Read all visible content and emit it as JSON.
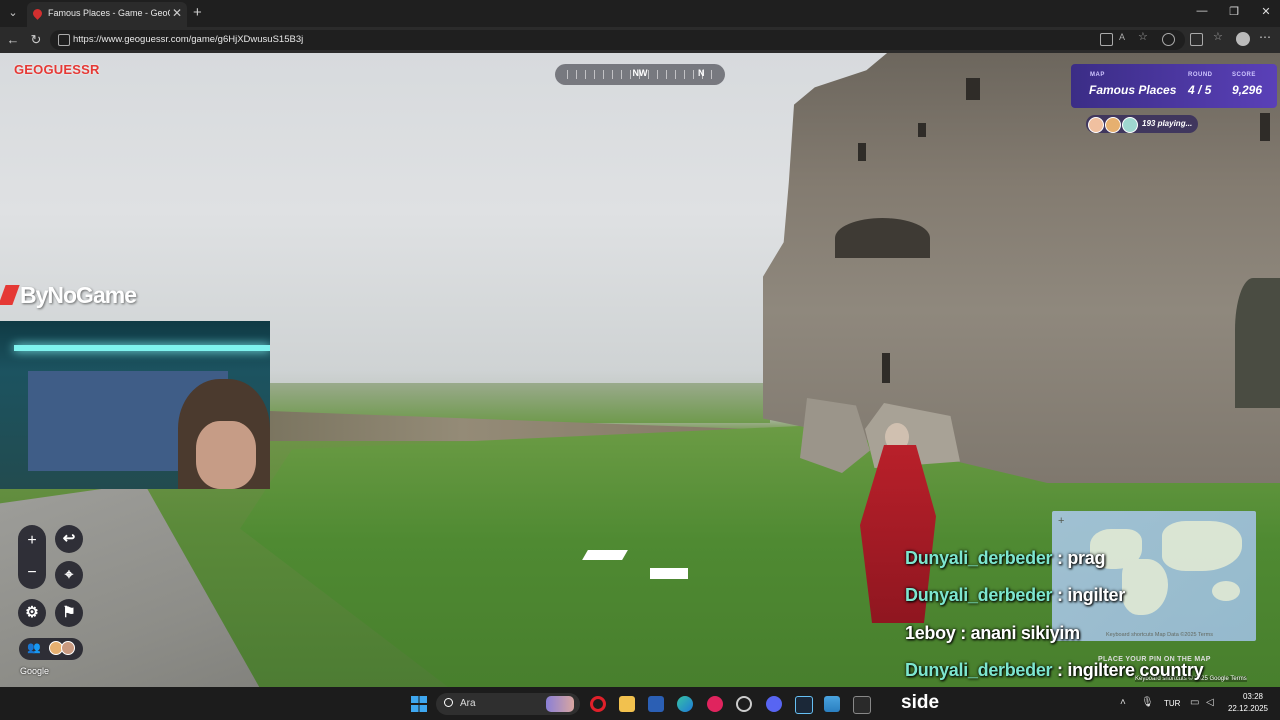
{
  "browser": {
    "tab_title": "Famous Places - Game - GeoGuessr",
    "url": "https://www.geoguessr.com/game/g6HjXDwusuS15B3j"
  },
  "game": {
    "logo": "GEOGUESSR",
    "compass_heading": "NW",
    "compass_next": "N",
    "map_label": "MAP",
    "map_name": "Famous Places",
    "round_label": "ROUND",
    "round_value": "4 / 5",
    "score_label": "SCORE",
    "score_value": "9,296",
    "players_text": "193 playing...",
    "google_mark": "Google",
    "minimap_footer": "Keyboard shortcuts    Map Data ©2025    Terms",
    "map_place_hint": "PLACE YOUR PIN ON THE MAP",
    "google_footer": "Keyboard shortcuts  © 2025 Google  Terms",
    "controls": {
      "zoom_in": "+",
      "zoom_out": "−",
      "undo": "↩",
      "pin": "⌖",
      "settings": "⚙",
      "flag": "⚑"
    }
  },
  "overlay": {
    "brand": "ByNoGame",
    "chat": [
      {
        "user": "Dunyali_derbeder",
        "message": ": prag"
      },
      {
        "user": "Dunyali_derbeder",
        "message": ": ingilter"
      },
      {
        "user": "1eboy",
        "message": ": anani sikiyim"
      },
      {
        "user": "Dunyali_derbeder",
        "message": ": ingiltere country"
      }
    ]
  },
  "taskbar": {
    "search_placeholder": "Ara",
    "side_text": "side",
    "language": "TUR",
    "time": "03:28",
    "date": "22.12.2025"
  }
}
